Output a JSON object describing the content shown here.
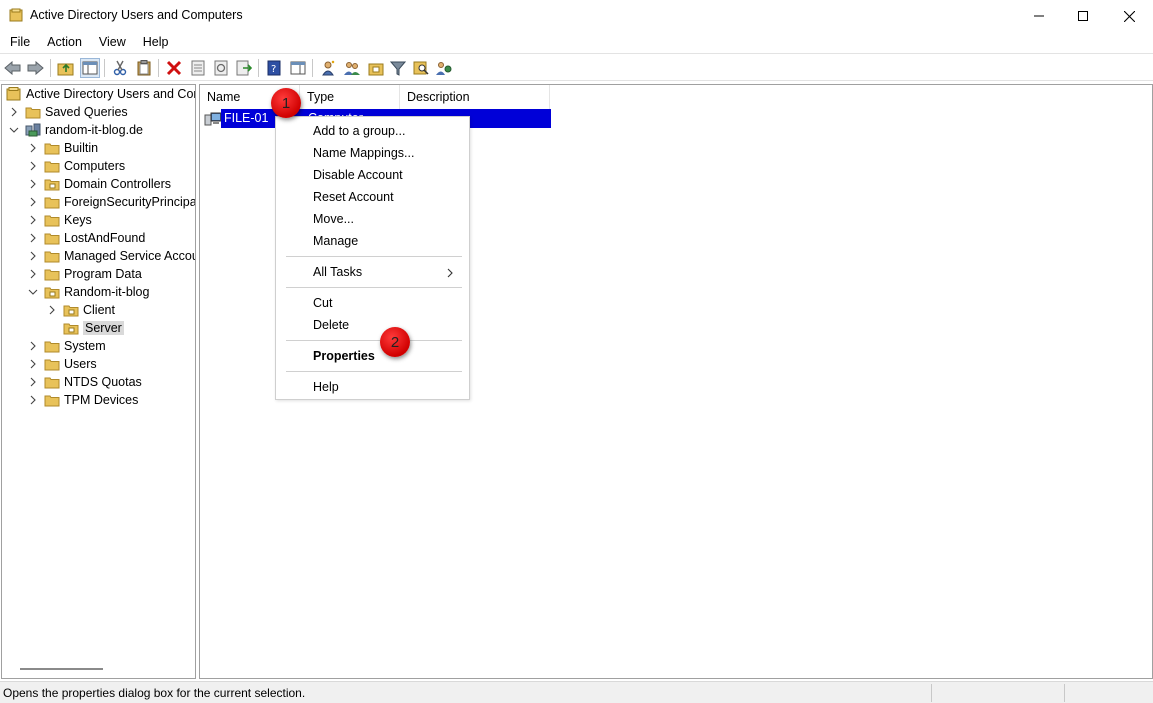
{
  "window": {
    "title": "Active Directory Users and Computers"
  },
  "menubar": {
    "items": [
      "File",
      "Action",
      "View",
      "Help"
    ]
  },
  "tree": {
    "root": "Active Directory Users and Com",
    "saved_queries": "Saved Queries",
    "domain": "random-it-blog.de",
    "children": [
      "Builtin",
      "Computers",
      "Domain Controllers",
      "ForeignSecurityPrincipals",
      "Keys",
      "LostAndFound",
      "Managed Service Accour",
      "Program Data",
      "Random-it-blog"
    ],
    "ou_children": [
      "Client",
      "Server"
    ],
    "after": [
      "System",
      "Users",
      "NTDS Quotas",
      "TPM Devices"
    ]
  },
  "list": {
    "columns": [
      "Name",
      "Type",
      "Description"
    ],
    "rows": [
      {
        "name": "FILE-01",
        "type": "Computer",
        "description": ""
      }
    ]
  },
  "context_menu": {
    "items": [
      "Add to a group...",
      "Name Mappings...",
      "Disable Account",
      "Reset Account",
      "Move...",
      "Manage",
      "All Tasks",
      "Cut",
      "Delete",
      "Properties",
      "Help"
    ]
  },
  "markers": [
    "1",
    "2"
  ],
  "status": {
    "text": "Opens the properties dialog box for the current selection."
  },
  "colors": {
    "selection": "#0000d8",
    "marker": "#e00000",
    "folder": "#e8c25a"
  }
}
